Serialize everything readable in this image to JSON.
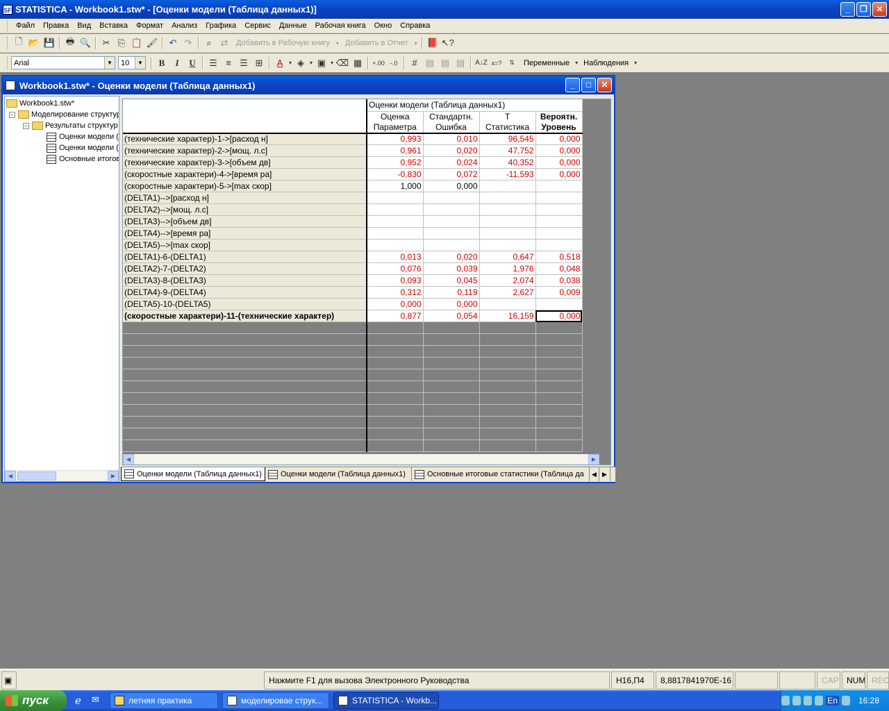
{
  "app": {
    "title": "STATISTICA - Workbook1.stw* - [Оценки модели (Таблица данных1)]",
    "logo_text": "SF"
  },
  "menu": [
    "Файл",
    "Правка",
    "Вид",
    "Вставка",
    "Формат",
    "Анализ",
    "Графика",
    "Сервис",
    "Данные",
    "Рабочая книга",
    "Окно",
    "Справка"
  ],
  "toolbar1": {
    "add_to_workbook": "Добавить в Рабочую книгу",
    "add_to_report": "Добавить в Отчет"
  },
  "toolbar2": {
    "font": "Arial",
    "font_size": "10",
    "bold": "B",
    "italic": "I",
    "underline": "U",
    "variables": "Переменные",
    "cases": "Наблюдения"
  },
  "workbook": {
    "title": "Workbook1.stw* - Оценки модели (Таблица данных1)",
    "tree": [
      {
        "label": "Workbook1.stw*",
        "icon": "folder-icon",
        "level": 0
      },
      {
        "label": "Моделирование структур",
        "icon": "folder-icon",
        "level": 1
      },
      {
        "label": "Результаты структур",
        "icon": "folder-icon",
        "level": 2
      },
      {
        "label": "Оценки модели (",
        "icon": "table-icon",
        "level": 3
      },
      {
        "label": "Оценки модели (",
        "icon": "table-icon",
        "level": 3
      },
      {
        "label": "Основные итогов",
        "icon": "table-icon",
        "level": 3
      }
    ],
    "grid": {
      "group_header": "Оценки модели (Таблица данных1)",
      "columns": [
        {
          "l1": "Оценка",
          "l2": "Параметра"
        },
        {
          "l1": "Стандартн.",
          "l2": "Ошибка"
        },
        {
          "l1": "T",
          "l2": "Статистика"
        },
        {
          "l1": "Вероятн.",
          "l2": "Уровень"
        }
      ],
      "rows": [
        {
          "label": "(технические характер)-1->[расход н]",
          "values": [
            "0,993",
            "0,010",
            "96,545",
            "0,000"
          ]
        },
        {
          "label": "(технические характер)-2->[мощ. л.с]",
          "values": [
            "0,961",
            "0,020",
            "47,752",
            "0,000"
          ]
        },
        {
          "label": "(технические характер)-3->[объем дв]",
          "values": [
            "0,952",
            "0,024",
            "40,352",
            "0,000"
          ]
        },
        {
          "label": "(скоростные характери)-4->[время ра]",
          "values": [
            "-0,830",
            "0,072",
            "-11,593",
            "0,000"
          ]
        },
        {
          "label": "(скоростные характери)-5->[max скор]",
          "values": [
            "1,000",
            "0,000",
            "",
            ""
          ]
        },
        {
          "label": "(DELTA1)-->[расход н]",
          "values": [
            "",
            "",
            "",
            ""
          ]
        },
        {
          "label": "(DELTA2)-->[мощ. л.с]",
          "values": [
            "",
            "",
            "",
            ""
          ]
        },
        {
          "label": "(DELTA3)-->[объем дв]",
          "values": [
            "",
            "",
            "",
            ""
          ]
        },
        {
          "label": "(DELTA4)-->[время ра]",
          "values": [
            "",
            "",
            "",
            ""
          ]
        },
        {
          "label": "(DELTA5)-->[max скор]",
          "values": [
            "",
            "",
            "",
            ""
          ]
        },
        {
          "label": "(DELTA1)-6-(DELTA1)",
          "values": [
            "0,013",
            "0,020",
            "0,647",
            "0,518"
          ]
        },
        {
          "label": "(DELTA2)-7-(DELTA2)",
          "values": [
            "0,076",
            "0,039",
            "1,976",
            "0,048"
          ]
        },
        {
          "label": "(DELTA3)-8-(DELTA3)",
          "values": [
            "0,093",
            "0,045",
            "2,074",
            "0,038"
          ]
        },
        {
          "label": "(DELTA4)-9-(DELTA4)",
          "values": [
            "0,312",
            "0,119",
            "2,627",
            "0,009"
          ]
        },
        {
          "label": "(DELTA5)-10-(DELTA5)",
          "values": [
            "0,000",
            "0,000",
            "",
            ""
          ]
        },
        {
          "label": "(скоростные характери)-11-(технические характер)",
          "values": [
            "0,877",
            "0,054",
            "16,159",
            "0,000"
          ]
        }
      ]
    },
    "tabs": [
      "Оценки модели (Таблица данных1)",
      "Оценки модели (Таблица данных1)",
      "Основные итоговые статистики (Таблица да"
    ]
  },
  "status": {
    "help": "Нажмите F1 для вызова Электронного Руководства",
    "cell_ref": "H16,П4",
    "value": "8,8817841970E-16",
    "cap": "CAP",
    "num": "NUM",
    "rec": "REC"
  },
  "taskbar": {
    "start": "пуск",
    "tasks": [
      "летняя практика",
      "моделировае струк...",
      "STATISTICA - Workb..."
    ],
    "lang": "En",
    "time": "16:28"
  }
}
